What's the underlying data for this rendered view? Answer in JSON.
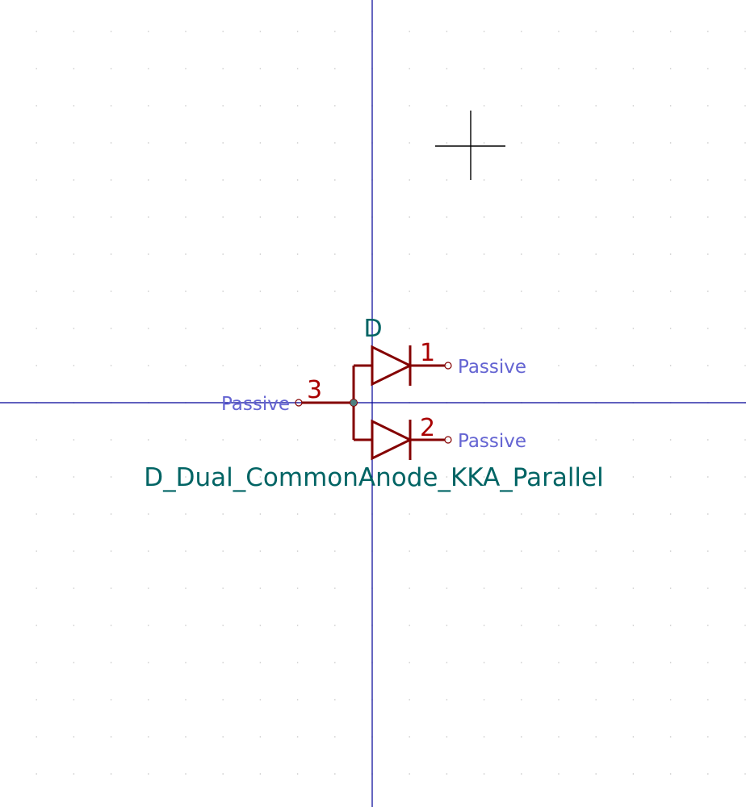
{
  "symbol": {
    "reference": "D",
    "value": "D_Dual_CommonAnode_KKA_Parallel",
    "pins": [
      {
        "number": "1",
        "type": "Passive"
      },
      {
        "number": "2",
        "type": "Passive"
      },
      {
        "number": "3",
        "type": "Passive"
      }
    ]
  },
  "colors": {
    "background": "#ffffff",
    "grid_dot": "#c8c8c8",
    "axis": "#000096",
    "body": "#840000",
    "pin_number": "#a90000",
    "pin_type": "#6464d2",
    "field": "#006464",
    "cursor": "#000000",
    "junction": "#4d8080"
  },
  "icons": {
    "cursor": "crosshair-cursor-icon",
    "junction": "junction-dot-icon",
    "pin_end": "pin-endpoint-circle-icon"
  }
}
